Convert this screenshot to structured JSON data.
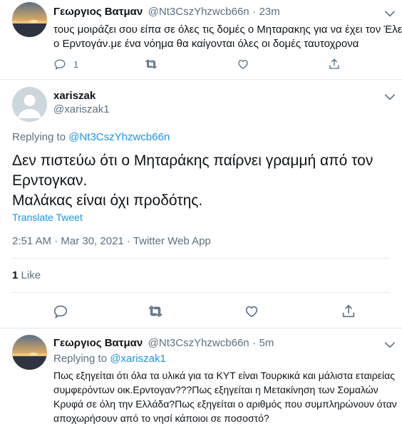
{
  "tweet1": {
    "name": "Γεωργιος Βατμαν",
    "handle": "@Nt3CszYhzwcb66n",
    "dot": "·",
    "time": "23m",
    "text_line1": "τους μοιράζει σου είπα σε όλες τις δομές ο Μηταρακης για να έχει τον Έλεγχο",
    "text_line2": "ο Ερντογάν.με ένα νόημα θα καίγονται όλες οι δομές ταυτοχρονα",
    "reply_count": "1"
  },
  "main_tweet": {
    "name": "xariszak",
    "handle": "@xariszak1",
    "replying_prefix": "Replying to",
    "replying_handle": "@Nt3CszYhzwcb66n",
    "text_line1": "Δεν πιστεύω ότι ο Μηταράκης παίρνει γραμμή από τον",
    "text_line2": "Ερντογκαν.",
    "text_line3": "Μαλάκας είναι όχι προδότης.",
    "translate": "Translate Tweet",
    "timestamp": "2:51 AM · Mar 30, 2021 · Twitter Web App",
    "likes_count": "1",
    "likes_label": "Like"
  },
  "tweet3": {
    "name": "Γεωργιος Βατμαν",
    "handle": "@Nt3CszYhzwcb66n",
    "dot": "·",
    "time": "5m",
    "replying_prefix": "Replying to",
    "replying_handle": "@xariszak1",
    "text_line1": "Πως εξηγείται ότι όλα τα υλικά για τα ΚΥΤ είναι Τουρκικά και μάλιστα εταιρείας",
    "text_line2": "συμφερόντων οικ.Ερντογαν???Πως εξηγείται η Μετακίνηση των Σομαλών",
    "text_line3": "Κρυφά σε όλη την Ελλάδα?Πως εξηγείται ο αριθμός που συμπληρώνουν όταν",
    "text_line4": "αποχωρήσουν από το νησί κάποιοι σε ποσοστό?"
  },
  "colors": {
    "text": "#0f1419",
    "muted": "#5b7083",
    "link": "#1b95e0",
    "divider": "#e1e8ed"
  },
  "icons": [
    "chevron-down-icon",
    "reply-icon",
    "retweet-icon",
    "like-icon",
    "share-icon",
    "avatar"
  ]
}
